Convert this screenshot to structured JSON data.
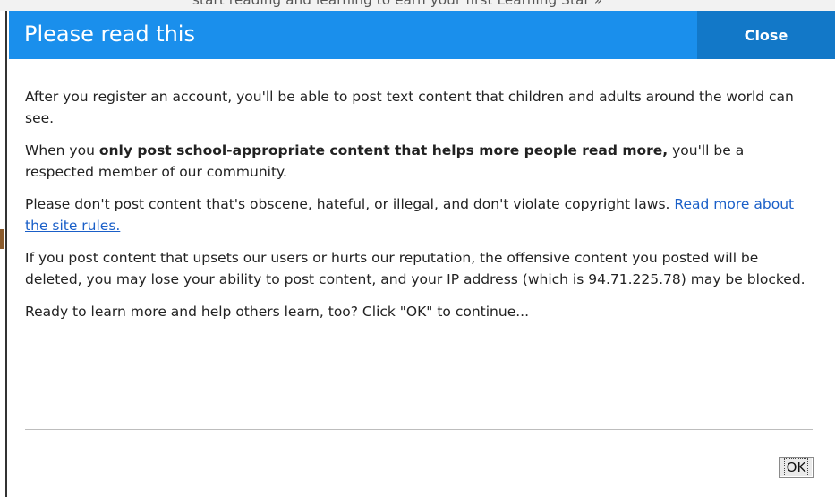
{
  "background": {
    "partial_text": "start reading and learning to earn your first Learning Star »"
  },
  "dialog": {
    "title": "Please read this",
    "close_label": "Close",
    "paragraphs": {
      "p1": "After you register an account, you'll be able to post text content that children and adults around the world can see.",
      "p2_pre": "When you ",
      "p2_bold": "only post school-appropriate content that helps more people read more,",
      "p2_post": " you'll be a respected member of our community.",
      "p3_text": "Please don't post content that's obscene, hateful, or illegal, and don't violate copyright laws. ",
      "p3_link": "Read more about the site rules.",
      "p4": "If you post content that upsets our users or hurts our reputation, the offensive content you posted will be deleted, you may lose your ability to post content, and your IP address (which is 94.71.225.78) may be blocked.",
      "p5": "Ready to learn more and help others learn, too? Click \"OK\" to continue..."
    },
    "ok_label": "OK"
  },
  "colors": {
    "header_blue": "#1a8fec",
    "close_blue": "#1278c8",
    "link_blue": "#1a5fc8"
  }
}
